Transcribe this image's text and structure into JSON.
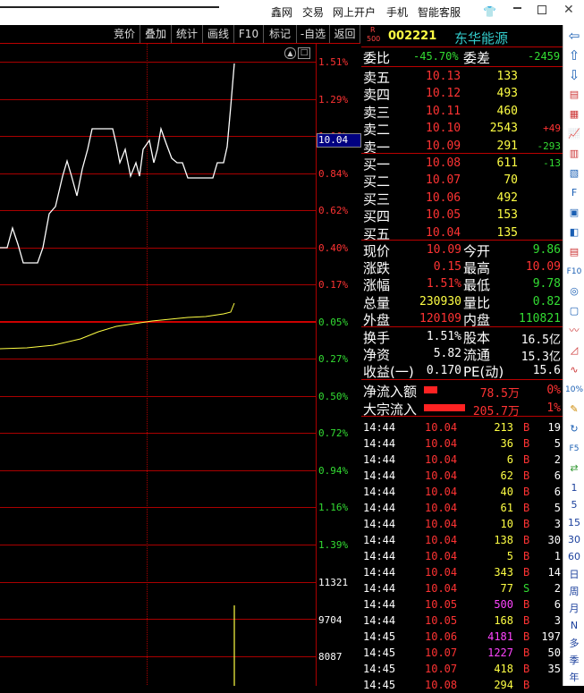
{
  "top_menu": [
    "鑫网",
    "交易",
    "网上开户",
    "手机",
    "智能客服"
  ],
  "toolbar": [
    "竞价",
    "叠加",
    "统计",
    "画线",
    "F10",
    "标记",
    "-自选",
    "返回"
  ],
  "cursor_price": "10.04",
  "price_axis": [
    {
      "label": "1.51%",
      "cls": "up"
    },
    {
      "label": "1.29%",
      "cls": "up"
    },
    {
      "label": "1.06%",
      "cls": "up"
    },
    {
      "label": "0.84%",
      "cls": "up"
    },
    {
      "label": "0.62%",
      "cls": "up"
    },
    {
      "label": "0.40%",
      "cls": "up"
    },
    {
      "label": "0.17%",
      "cls": "up"
    },
    {
      "label": "0.05%",
      "cls": "dn"
    },
    {
      "label": "0.27%",
      "cls": "dn"
    },
    {
      "label": "0.50%",
      "cls": "dn"
    },
    {
      "label": "0.72%",
      "cls": "dn"
    },
    {
      "label": "0.94%",
      "cls": "dn"
    },
    {
      "label": "1.16%",
      "cls": "dn"
    },
    {
      "label": "1.39%",
      "cls": "dn"
    }
  ],
  "volume_axis": [
    "11321",
    "9704",
    "8087"
  ],
  "stock": {
    "badge_r": "R",
    "badge_num": "500",
    "code": "002221",
    "name": "东华能源"
  },
  "order_ratio": {
    "label1": "委比",
    "value1": "-45.70%",
    "label2": "委差",
    "value2": "-2459"
  },
  "asks": [
    {
      "label": "卖五",
      "price": "10.13",
      "vol": "133",
      "chg": ""
    },
    {
      "label": "卖四",
      "price": "10.12",
      "vol": "493",
      "chg": ""
    },
    {
      "label": "卖三",
      "price": "10.11",
      "vol": "460",
      "chg": ""
    },
    {
      "label": "卖二",
      "price": "10.10",
      "vol": "2543",
      "chg": "+49"
    },
    {
      "label": "卖一",
      "price": "10.09",
      "vol": "291",
      "chg": "-293"
    }
  ],
  "bids": [
    {
      "label": "买一",
      "price": "10.08",
      "vol": "611",
      "chg": "-13"
    },
    {
      "label": "买二",
      "price": "10.07",
      "vol": "70",
      "chg": ""
    },
    {
      "label": "买三",
      "price": "10.06",
      "vol": "492",
      "chg": ""
    },
    {
      "label": "买四",
      "price": "10.05",
      "vol": "153",
      "chg": ""
    },
    {
      "label": "买五",
      "price": "10.04",
      "vol": "135",
      "chg": ""
    }
  ],
  "quote": [
    {
      "l1": "现价",
      "v1": "10.09",
      "c1": "up",
      "l2": "今开",
      "v2": "9.86",
      "c2": "dn"
    },
    {
      "l1": "涨跌",
      "v1": "0.15",
      "c1": "up",
      "l2": "最高",
      "v2": "10.09",
      "c2": "up"
    },
    {
      "l1": "涨幅",
      "v1": "1.51%",
      "c1": "up",
      "l2": "最低",
      "v2": "9.78",
      "c2": "dn"
    },
    {
      "l1": "总量",
      "v1": "230930",
      "c1": "ylw",
      "l2": "量比",
      "v2": "0.82",
      "c2": "dn"
    },
    {
      "l1": "外盘",
      "v1": "120109",
      "c1": "up",
      "l2": "内盘",
      "v2": "110821",
      "c2": "dn"
    }
  ],
  "finance": [
    {
      "l1": "换手",
      "v1": "1.51%",
      "l2": "股本",
      "v2": "16.5亿"
    },
    {
      "l1": "净资",
      "v1": "5.82",
      "l2": "流通",
      "v2": "15.3亿"
    },
    {
      "l1": "收益(一)",
      "v1": "0.170",
      "l2": "PE(动)",
      "v2": "15.6"
    }
  ],
  "flow": [
    {
      "label": "净流入额",
      "value": "78.5万",
      "pct": "0%",
      "bar": 0.32
    },
    {
      "label": "大宗流入",
      "value": "205.7万",
      "pct": "1%",
      "bar": 1.0
    }
  ],
  "trades": [
    {
      "time": "14:44",
      "price": "10.04",
      "vol": "213",
      "bs": "B",
      "n": "19",
      "vc": "ylw"
    },
    {
      "time": "14:44",
      "price": "10.04",
      "vol": "36",
      "bs": "B",
      "n": "5",
      "vc": "ylw"
    },
    {
      "time": "14:44",
      "price": "10.04",
      "vol": "6",
      "bs": "B",
      "n": "2",
      "vc": "ylw"
    },
    {
      "time": "14:44",
      "price": "10.04",
      "vol": "62",
      "bs": "B",
      "n": "6",
      "vc": "ylw"
    },
    {
      "time": "14:44",
      "price": "10.04",
      "vol": "40",
      "bs": "B",
      "n": "6",
      "vc": "ylw"
    },
    {
      "time": "14:44",
      "price": "10.04",
      "vol": "61",
      "bs": "B",
      "n": "5",
      "vc": "ylw"
    },
    {
      "time": "14:44",
      "price": "10.04",
      "vol": "10",
      "bs": "B",
      "n": "3",
      "vc": "ylw"
    },
    {
      "time": "14:44",
      "price": "10.04",
      "vol": "138",
      "bs": "B",
      "n": "30",
      "vc": "ylw"
    },
    {
      "time": "14:44",
      "price": "10.04",
      "vol": "5",
      "bs": "B",
      "n": "1",
      "vc": "ylw"
    },
    {
      "time": "14:44",
      "price": "10.04",
      "vol": "343",
      "bs": "B",
      "n": "14",
      "vc": "ylw"
    },
    {
      "time": "14:44",
      "price": "10.04",
      "vol": "77",
      "bs": "S",
      "n": "2",
      "vc": "ylw"
    },
    {
      "time": "14:44",
      "price": "10.05",
      "vol": "500",
      "bs": "B",
      "n": "6",
      "vc": "mag"
    },
    {
      "time": "14:44",
      "price": "10.05",
      "vol": "168",
      "bs": "B",
      "n": "3",
      "vc": "ylw"
    },
    {
      "time": "14:45",
      "price": "10.06",
      "vol": "4181",
      "bs": "B",
      "n": "197",
      "vc": "mag"
    },
    {
      "time": "14:45",
      "price": "10.07",
      "vol": "1227",
      "bs": "B",
      "n": "50",
      "vc": "mag"
    },
    {
      "time": "14:45",
      "price": "10.07",
      "vol": "418",
      "bs": "B",
      "n": "35",
      "vc": "ylw"
    },
    {
      "time": "14:45",
      "price": "10.08",
      "vol": "294",
      "bs": "B",
      "n": "",
      "vc": "ylw"
    }
  ],
  "sidebar_labels": [
    "1",
    "5",
    "15",
    "30",
    "60",
    "日",
    "周",
    "月",
    "N",
    "多",
    "季",
    "年"
  ],
  "colors": {
    "up": "#ff3333",
    "down": "#33dd33",
    "grid": "#aa0000",
    "volume_text": "#ffff44",
    "big_order": "#ff44ff"
  }
}
